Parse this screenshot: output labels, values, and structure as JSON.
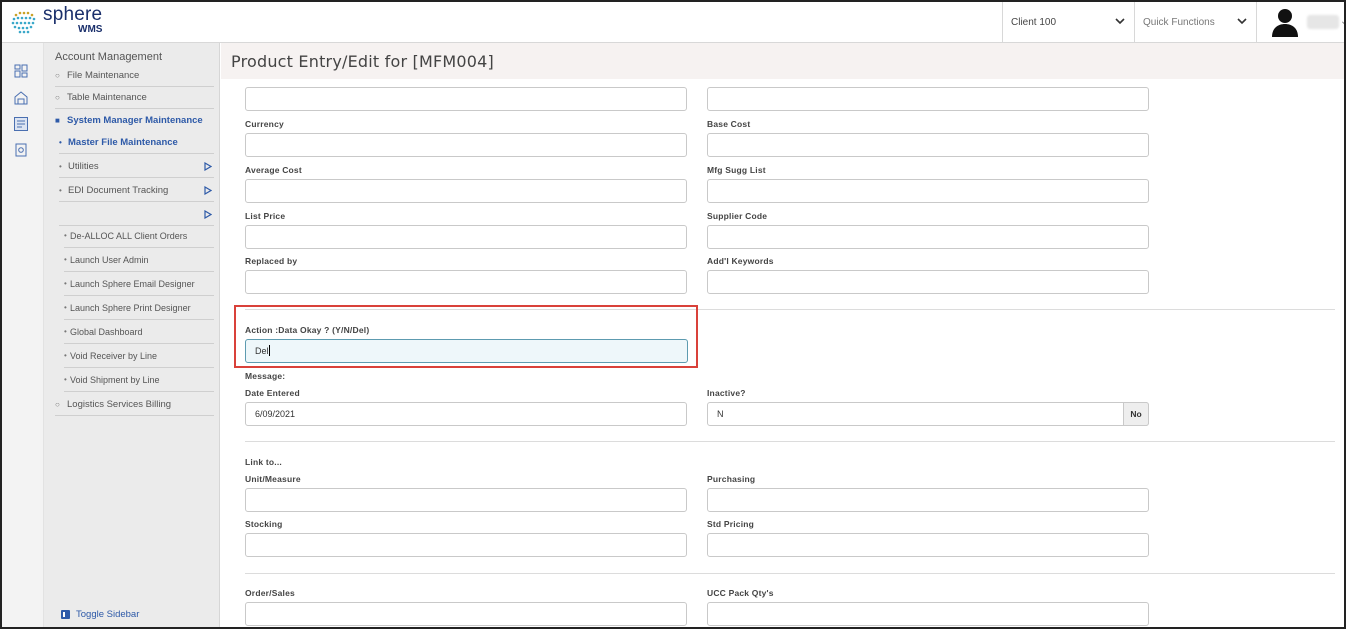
{
  "brand": {
    "name": "sphere",
    "sub": "WMS"
  },
  "header": {
    "client_select": "Client 100",
    "quick_functions": "Quick Functions"
  },
  "sidebar": {
    "title": "Account Management",
    "items": [
      {
        "label": "File Maintenance"
      },
      {
        "label": "Table Maintenance"
      },
      {
        "label": "System Manager Maintenance"
      },
      {
        "label": "Master File Maintenance"
      },
      {
        "label": "Utilities"
      },
      {
        "label": "EDI Document Tracking"
      },
      {
        "label": ""
      }
    ],
    "subitems": [
      "De-ALLOC ALL Client Orders",
      "Launch User Admin",
      "Launch Sphere Email Designer",
      "Launch Sphere Print Designer",
      "Global Dashboard",
      "Void Receiver by Line",
      "Void Shipment by Line"
    ],
    "billing": "Logistics Services Billing",
    "toggle": "Toggle Sidebar"
  },
  "page": {
    "title": "Product Entry/Edit for [MFM004]"
  },
  "form": {
    "currency": {
      "label": "Currency",
      "value": ""
    },
    "base_cost": {
      "label": "Base Cost",
      "value": ""
    },
    "average_cost": {
      "label": "Average Cost",
      "value": ""
    },
    "mfg_sugg_list": {
      "label": "Mfg Sugg List",
      "value": ""
    },
    "list_price": {
      "label": "List Price",
      "value": ""
    },
    "supplier_code": {
      "label": "Supplier Code",
      "value": ""
    },
    "replaced_by": {
      "label": "Replaced by",
      "value": ""
    },
    "keywords": {
      "label": "Add'l Keywords",
      "value": ""
    },
    "action": {
      "label": "Action :Data Okay ? (Y/N/Del)",
      "value": "Del"
    },
    "message": {
      "label": "Message:"
    },
    "date_entered": {
      "label": "Date Entered",
      "value": "6/09/2021"
    },
    "inactive": {
      "label": "Inactive?",
      "value": "N",
      "addon": "No"
    },
    "link_to": "Link to...",
    "unit_measure": {
      "label": "Unit/Measure",
      "value": ""
    },
    "purchasing": {
      "label": "Purchasing",
      "value": ""
    },
    "stocking": {
      "label": "Stocking",
      "value": ""
    },
    "std_pricing": {
      "label": "Std Pricing",
      "value": ""
    },
    "order_sales": {
      "label": "Order/Sales",
      "value": ""
    },
    "ucc_pack": {
      "label": "UCC Pack Qty's",
      "value": ""
    }
  },
  "colors": {
    "accent": "#2e5aa8",
    "highlight": "#d9413a",
    "brand": "#1a2f6b"
  }
}
